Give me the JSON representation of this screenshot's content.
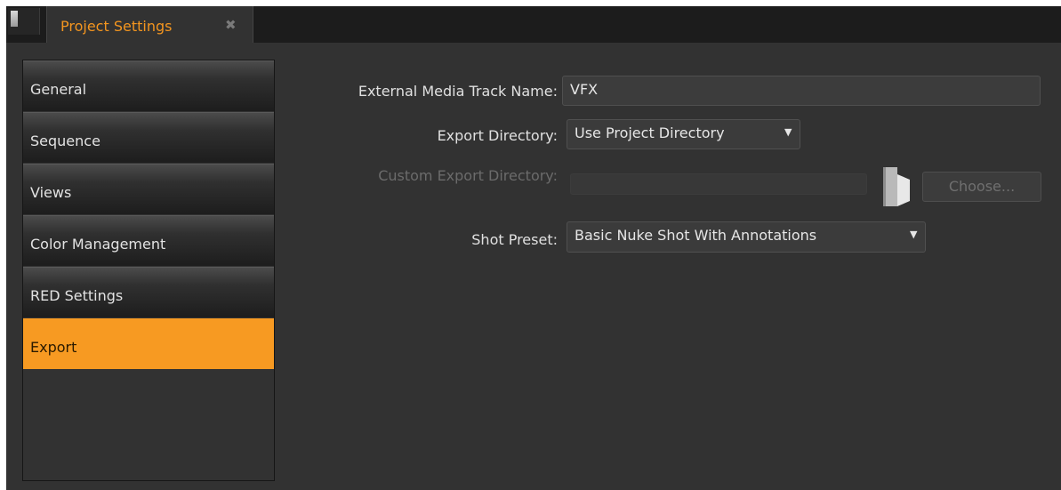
{
  "tab": {
    "title": "Project Settings",
    "close_glyph": "✖",
    "close_icon": "close-icon"
  },
  "sidebar": {
    "items": [
      {
        "label": "General",
        "active": false
      },
      {
        "label": "Sequence",
        "active": false
      },
      {
        "label": "Views",
        "active": false
      },
      {
        "label": "Color Management",
        "active": false
      },
      {
        "label": "RED Settings",
        "active": false
      },
      {
        "label": "Export",
        "active": true
      }
    ]
  },
  "form": {
    "track_name": {
      "label": "External Media Track Name:",
      "value": "VFX"
    },
    "export_directory": {
      "label": "Export Directory:",
      "value": "Use Project Directory",
      "caret": "▼"
    },
    "custom_export_directory": {
      "label": "Custom Export Directory:",
      "value": "",
      "disabled": true,
      "folder_icon": "folder-icon",
      "choose_label": "Choose..."
    },
    "shot_preset": {
      "label": "Shot Preset:",
      "value": "Basic Nuke Shot With Annotations",
      "caret": "▼"
    }
  },
  "colors": {
    "accent": "#f79a22",
    "background": "#323232",
    "tabbar": "#1c1c1c"
  }
}
